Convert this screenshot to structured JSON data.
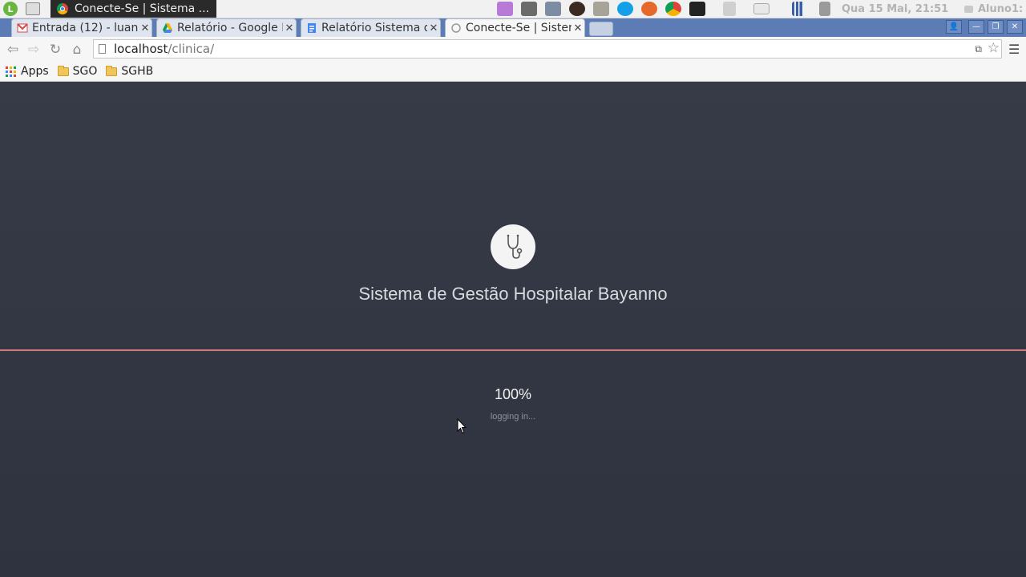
{
  "os_panel": {
    "taskbar_window_title": "Conecte-Se | Sistema ...",
    "datetime": "Qua 15 Mai, 21:51",
    "user": "Aluno1:",
    "tray_icons": [
      "notes-icon",
      "camera-icon",
      "books-icon",
      "app-icon",
      "folder-icon",
      "skype-icon",
      "firefox-icon",
      "chrome-icon",
      "terminal-icon",
      "recorder-icon",
      "mail-icon",
      "network-icon",
      "volume-icon"
    ]
  },
  "browser": {
    "tabs": [
      {
        "title": "Entrada (12) - luan",
        "icon": "gmail-icon"
      },
      {
        "title": "Relatório - Google D",
        "icon": "drive-icon"
      },
      {
        "title": "Relatório Sistema de",
        "icon": "docs-icon"
      },
      {
        "title": "Conecte-Se | Sistema",
        "icon": "page-icon"
      }
    ],
    "active_tab": 3,
    "url_host": "localhost",
    "url_path": "/clinica/",
    "bookmarks": [
      {
        "label": "Apps",
        "icon": "apps-grid-icon"
      },
      {
        "label": "SGO",
        "icon": "folder-icon"
      },
      {
        "label": "SGHB",
        "icon": "folder-icon"
      }
    ]
  },
  "page": {
    "logo_icon": "stethoscope-icon",
    "title": "Sistema de Gestão Hospitalar Bayanno",
    "progress_percent_label": "100%",
    "progress": 1.0,
    "status_text": "logging in..."
  },
  "colors": {
    "page_background": "#353a46",
    "progress_line": "#d9787b",
    "tab_strip": "#5b7cb5"
  }
}
